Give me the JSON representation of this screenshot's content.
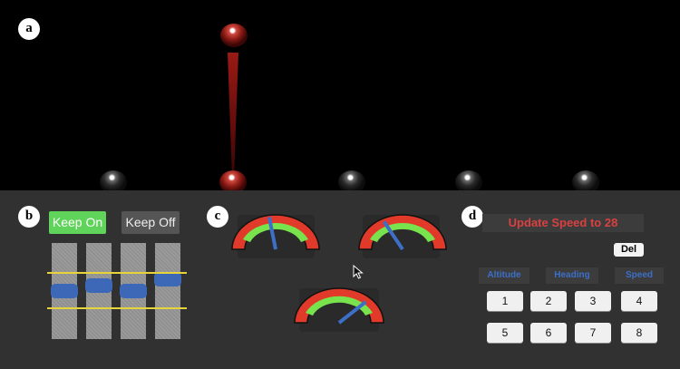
{
  "labels": {
    "a": "a",
    "b": "b",
    "c": "c",
    "d": "d"
  },
  "panel_b": {
    "keep_on": "Keep On",
    "keep_off": "Keep Off",
    "slider_levels": [
      0.5,
      0.57,
      0.5,
      0.65
    ]
  },
  "panel_c": {
    "gauge_values": [
      0.44,
      0.32,
      0.78
    ]
  },
  "panel_d": {
    "status": "Update Speed to 28",
    "delete": "Del",
    "tabs": [
      "Altitude",
      "Heading",
      "Speed"
    ],
    "keys": [
      "1",
      "2",
      "3",
      "4",
      "5",
      "6",
      "7",
      "8"
    ]
  },
  "colors": {
    "keep_on": "#5fd35a",
    "status_text": "#d94141",
    "tab_text": "#3d6fc8",
    "slider_handle": "#3d68b8",
    "threshold_line": "#e6d43a"
  },
  "icons": [
    "mouse-cursor-icon"
  ]
}
